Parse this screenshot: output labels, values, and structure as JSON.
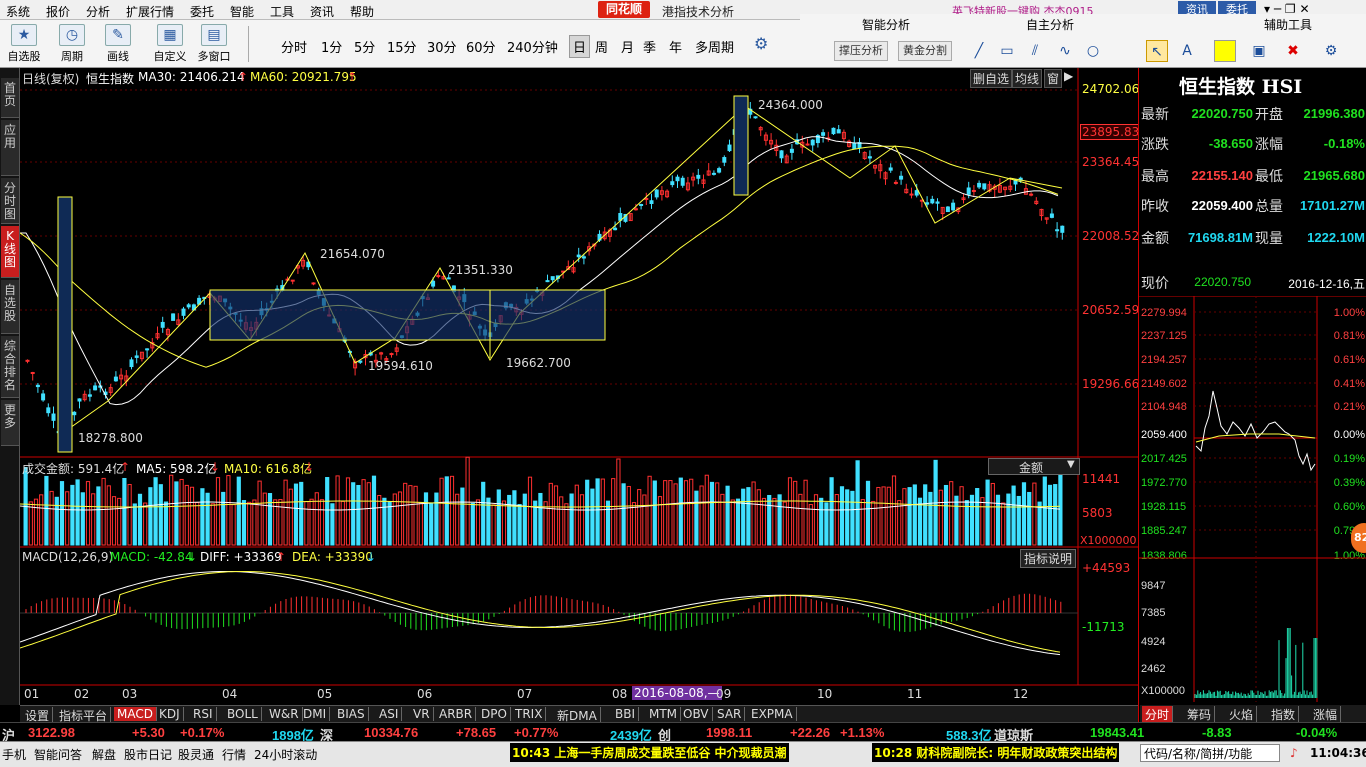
{
  "menu": {
    "items": [
      "系统",
      "报价",
      "分析",
      "扩展行情",
      "委托",
      "智能",
      "工具",
      "资讯",
      "帮助"
    ],
    "brand": "同花顺",
    "title": "港指技术分析",
    "ticker": "英飞特新股一键购  杰杰0915",
    "btn1": "资讯",
    "btn2": "委托"
  },
  "toolbar": {
    "buttons": [
      {
        "label": "自选股",
        "icon": "star-icon"
      },
      {
        "label": "周期",
        "icon": "clock-icon"
      },
      {
        "label": "画线",
        "icon": "pencil-icon"
      },
      {
        "label": "自定义",
        "icon": "custom-icon"
      },
      {
        "label": "多窗口",
        "icon": "grid-icon"
      }
    ],
    "periods": [
      "分时",
      "1分",
      "5分",
      "15分",
      "30分",
      "60分",
      "240分钟",
      "日",
      "周",
      "月",
      "季",
      "年",
      "多周期"
    ],
    "selected_period": "日"
  },
  "toolpanel": {
    "smart": "智能分析",
    "self": "自主分析",
    "aux": "辅助工具",
    "btn_pressure": "撑压分析",
    "btn_golden": "黄金分割"
  },
  "leftnav": [
    "首页",
    "应用",
    "分时图",
    "K线图",
    "自选股",
    "综合排名",
    "更多"
  ],
  "chart": {
    "header_left": "日线(复权)",
    "name": "恒生指数",
    "ma30_label": "MA30: 21406.214",
    "ma60_label": "MA60: 20921.795",
    "header_right": [
      "删自选",
      "均线",
      "窗"
    ],
    "price_ticks": [
      "24702.06",
      "23895.83",
      "23364.45",
      "22008.52",
      "20652.59",
      "19296.66"
    ],
    "current_price_tag": "23895.83",
    "annotations": [
      "24364.000",
      "21654.070",
      "21351.330",
      "19594.610",
      "19662.700",
      "18278.800"
    ],
    "vol_label": "成交金额: 591.4亿",
    "vol_ma5": "MA5: 598.2亿",
    "vol_ma10": "MA10: 616.8亿",
    "vol_select": "金额",
    "vol_ticks": [
      "11441",
      "5803",
      "X1000000"
    ],
    "macd_label": "MACD(12,26,9)",
    "macd_val": "MACD: -42.84",
    "diff": "DIFF: +33369",
    "dea": "DEA: +33390",
    "macd_help": "指标说明",
    "macd_ticks": [
      "+44593",
      "-11713"
    ],
    "months": [
      "01",
      "02",
      "03",
      "04",
      "05",
      "06",
      "07",
      "08",
      "09",
      "10",
      "11",
      "12"
    ],
    "date_tag": "2016-08-08,—"
  },
  "quote": {
    "title": "恒生指数 HSI",
    "latest_label": "最新",
    "latest": "22020.750",
    "open_label": "开盘",
    "open": "21996.380",
    "chg_label": "涨跌",
    "chg": "-38.650",
    "pct_label": "涨幅",
    "pct": "-0.18%",
    "high_label": "最高",
    "high": "22155.140",
    "low_label": "最低",
    "low": "21965.680",
    "prev_label": "昨收",
    "prev": "22059.400",
    "vol_label": "总量",
    "vol": "17101.27M",
    "amt_label": "金额",
    "amt": "71698.81M",
    "cur_label": "现量",
    "cur": "1222.10M",
    "now_label": "现价",
    "now": "22020.750",
    "date": "2016-12-16,五"
  },
  "mini": {
    "left_ticks": [
      "2279.994",
      "2237.125",
      "2194.257",
      "2149.602",
      "2104.948",
      "2059.400",
      "2017.425",
      "1972.770",
      "1928.115",
      "1885.247",
      "1838.806",
      "9847",
      "7385",
      "4924",
      "2462",
      "X100000"
    ],
    "right_ticks": [
      "1.00%",
      "0.81%",
      "0.61%",
      "0.41%",
      "0.21%",
      "0.00%",
      "0.19%",
      "0.39%",
      "0.60%",
      "0.79%",
      "1.00%"
    ],
    "badge": "82"
  },
  "tabs": [
    "设置",
    "指标平台",
    "MACD",
    "KDJ",
    "RSI",
    "BOLL",
    "W&R",
    "DMI",
    "BIAS",
    "ASI",
    "VR",
    "ARBR",
    "DPO",
    "TRIX",
    "新DMA",
    "BBI",
    "MTM",
    "OBV",
    "SAR",
    "EXPMA"
  ],
  "selected_tab": "MACD",
  "rtabs": [
    "分时",
    "筹码",
    "火焰",
    "指数",
    "涨幅"
  ],
  "ticker": {
    "sh_label": "沪",
    "sh": "3122.98",
    "sh_chg": "+5.30",
    "sh_pct": "+0.17%",
    "sh_amt": "1898亿",
    "sz_label": "深",
    "sz": "10334.76",
    "sz_chg": "+78.65",
    "sz_pct": "+0.77%",
    "sz_amt": "2439亿",
    "cy_label": "创",
    "cy": "1998.11",
    "cy_chg": "+22.26",
    "cy_pct": "+1.13%",
    "cy_amt": "588.3亿",
    "dj_label": "道琼斯",
    "dj": "19843.41",
    "dj_chg": "-8.83",
    "dj_pct": "-0.04%"
  },
  "status": {
    "items": [
      "手机",
      "智能问答",
      "解盘",
      "股市日记",
      "股灵通",
      "行情",
      "24小时滚动"
    ],
    "news1": "10:43 上海一手房周成交量跌至低谷 中介现裁员潮",
    "news2": "10:28 财科院副院长: 明年财政政策突出结构",
    "search": "代码/名称/简拼/功能",
    "time": "11:04:36"
  }
}
